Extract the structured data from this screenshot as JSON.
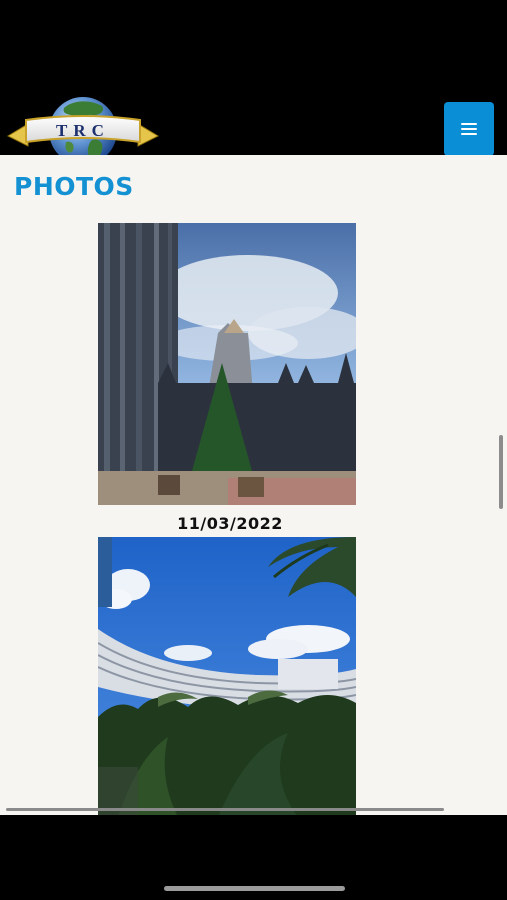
{
  "header": {
    "logo_text": "TRC",
    "menu_icon": "hamburger-menu-icon",
    "menu_color": "#0a8fd6"
  },
  "page": {
    "title": "PHOTOS",
    "title_color": "#1491d2",
    "background": "#f6f5f2"
  },
  "photos": [
    {
      "date": "",
      "subject": "city-plaza-christmas-tree"
    },
    {
      "date": "11/03/2022",
      "subject": "curved-hotel-with-palm-trees"
    }
  ]
}
